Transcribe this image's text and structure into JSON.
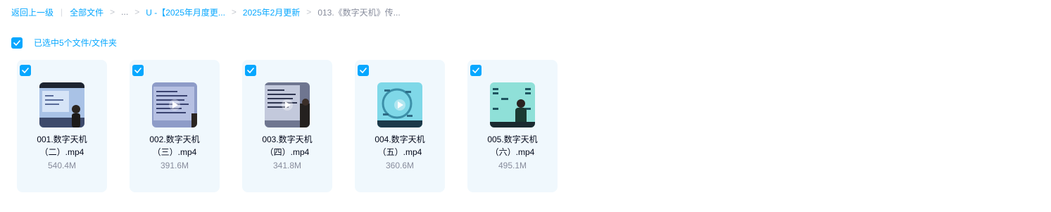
{
  "breadcrumb": {
    "back": "返回上一级",
    "all_files": "全部文件",
    "ellipsis": "...",
    "level1": "U -【2025年月度更...",
    "level2": "2025年2月更新",
    "current": "013.《数字天机》传..."
  },
  "selection": {
    "label": "已选中5个文件/文件夹",
    "checked": true
  },
  "files": [
    {
      "line1": "001.数字天机",
      "line2": "（二）.mp4",
      "size": "540.4M",
      "checked": true
    },
    {
      "line1": "002.数字天机",
      "line2": "（三）.mp4",
      "size": "391.6M",
      "checked": true
    },
    {
      "line1": "003.数字天机",
      "line2": "（四）.mp4",
      "size": "341.8M",
      "checked": true
    },
    {
      "line1": "004.数字天机",
      "line2": "（五）.mp4",
      "size": "360.6M",
      "checked": true
    },
    {
      "line1": "005.数字天机",
      "line2": "（六）.mp4",
      "size": "495.1M",
      "checked": true
    }
  ],
  "colors": {
    "accent": "#06a7ff",
    "card_bg": "#f0f8fd",
    "muted": "#878c9c"
  }
}
